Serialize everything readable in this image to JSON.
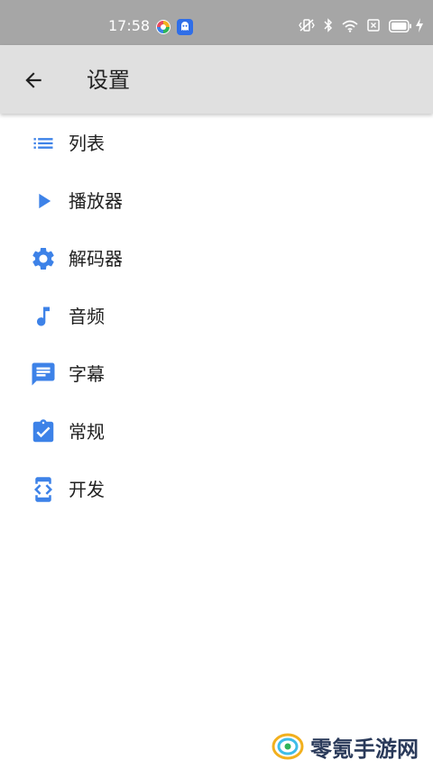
{
  "status_bar": {
    "time": "17:58"
  },
  "app_bar": {
    "title": "设置"
  },
  "menu": {
    "items": [
      {
        "label": "列表",
        "icon": "list-icon"
      },
      {
        "label": "播放器",
        "icon": "play-icon"
      },
      {
        "label": "解码器",
        "icon": "gear-icon"
      },
      {
        "label": "音频",
        "icon": "music-note-icon"
      },
      {
        "label": "字幕",
        "icon": "subtitle-message-icon"
      },
      {
        "label": "常规",
        "icon": "clipboard-check-icon"
      },
      {
        "label": "开发",
        "icon": "developer-mode-icon"
      }
    ]
  },
  "watermark": {
    "text": "零氪手游网"
  },
  "colors": {
    "accent": "#3d82e8",
    "status_bar": "#a6a6a6",
    "app_bar": "#e0e0e0",
    "text_primary": "#212121"
  }
}
